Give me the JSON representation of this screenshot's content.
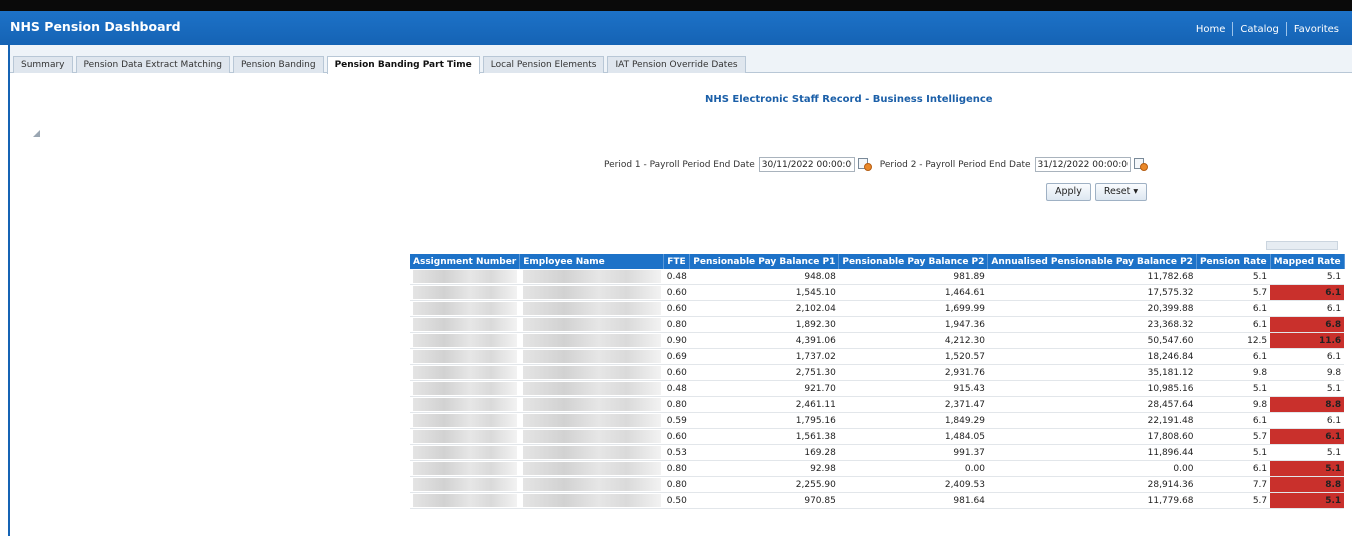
{
  "app": {
    "title": "NHS Pension Dashboard",
    "nav": [
      "Home",
      "Catalog",
      "Favorites"
    ]
  },
  "tabs": [
    {
      "label": "Summary",
      "active": false
    },
    {
      "label": "Pension Data Extract Matching",
      "active": false
    },
    {
      "label": "Pension Banding",
      "active": false
    },
    {
      "label": "Pension Banding Part Time",
      "active": true
    },
    {
      "label": "Local Pension Elements",
      "active": false
    },
    {
      "label": "IAT Pension Override Dates",
      "active": false
    }
  ],
  "report": {
    "title": "NHS Electronic Staff Record - Business Intelligence"
  },
  "prompts": {
    "period1_label": "Period 1 - Payroll Period End Date",
    "period1_value": "30/11/2022 00:00:00",
    "period2_label": "Period 2 - Payroll Period End Date",
    "period2_value": "31/12/2022 00:00:00",
    "apply_label": "Apply",
    "reset_label": "Reset ▾"
  },
  "colors": {
    "header": "#1d72c8",
    "highlight": "#c9302c"
  },
  "table": {
    "columns": [
      "Assignment Number",
      "Employee Name",
      "FTE",
      "Pensionable Pay Balance P1",
      "Pensionable Pay Balance P2",
      "Annualised Pensionable Pay Balance P2",
      "Pension Rate",
      "Mapped Rate"
    ],
    "rows": [
      {
        "fte": "0.48",
        "p1": "948.08",
        "p2": "981.89",
        "annual": "11,782.68",
        "rate": "5.1",
        "mapped": "5.1",
        "hl": false
      },
      {
        "fte": "0.60",
        "p1": "1,545.10",
        "p2": "1,464.61",
        "annual": "17,575.32",
        "rate": "5.7",
        "mapped": "6.1",
        "hl": true
      },
      {
        "fte": "0.60",
        "p1": "2,102.04",
        "p2": "1,699.99",
        "annual": "20,399.88",
        "rate": "6.1",
        "mapped": "6.1",
        "hl": false
      },
      {
        "fte": "0.80",
        "p1": "1,892.30",
        "p2": "1,947.36",
        "annual": "23,368.32",
        "rate": "6.1",
        "mapped": "6.8",
        "hl": true
      },
      {
        "fte": "0.90",
        "p1": "4,391.06",
        "p2": "4,212.30",
        "annual": "50,547.60",
        "rate": "12.5",
        "mapped": "11.6",
        "hl": true
      },
      {
        "fte": "0.69",
        "p1": "1,737.02",
        "p2": "1,520.57",
        "annual": "18,246.84",
        "rate": "6.1",
        "mapped": "6.1",
        "hl": false
      },
      {
        "fte": "0.60",
        "p1": "2,751.30",
        "p2": "2,931.76",
        "annual": "35,181.12",
        "rate": "9.8",
        "mapped": "9.8",
        "hl": false
      },
      {
        "fte": "0.48",
        "p1": "921.70",
        "p2": "915.43",
        "annual": "10,985.16",
        "rate": "5.1",
        "mapped": "5.1",
        "hl": false
      },
      {
        "fte": "0.80",
        "p1": "2,461.11",
        "p2": "2,371.47",
        "annual": "28,457.64",
        "rate": "9.8",
        "mapped": "8.8",
        "hl": true
      },
      {
        "fte": "0.59",
        "p1": "1,795.16",
        "p2": "1,849.29",
        "annual": "22,191.48",
        "rate": "6.1",
        "mapped": "6.1",
        "hl": false
      },
      {
        "fte": "0.60",
        "p1": "1,561.38",
        "p2": "1,484.05",
        "annual": "17,808.60",
        "rate": "5.7",
        "mapped": "6.1",
        "hl": true
      },
      {
        "fte": "0.53",
        "p1": "169.28",
        "p2": "991.37",
        "annual": "11,896.44",
        "rate": "5.1",
        "mapped": "5.1",
        "hl": false
      },
      {
        "fte": "0.80",
        "p1": "92.98",
        "p2": "0.00",
        "annual": "0.00",
        "rate": "6.1",
        "mapped": "5.1",
        "hl": true
      },
      {
        "fte": "0.80",
        "p1": "2,255.90",
        "p2": "2,409.53",
        "annual": "28,914.36",
        "rate": "7.7",
        "mapped": "8.8",
        "hl": true
      },
      {
        "fte": "0.50",
        "p1": "970.85",
        "p2": "981.64",
        "annual": "11,779.68",
        "rate": "5.7",
        "mapped": "5.1",
        "hl": true
      }
    ]
  }
}
